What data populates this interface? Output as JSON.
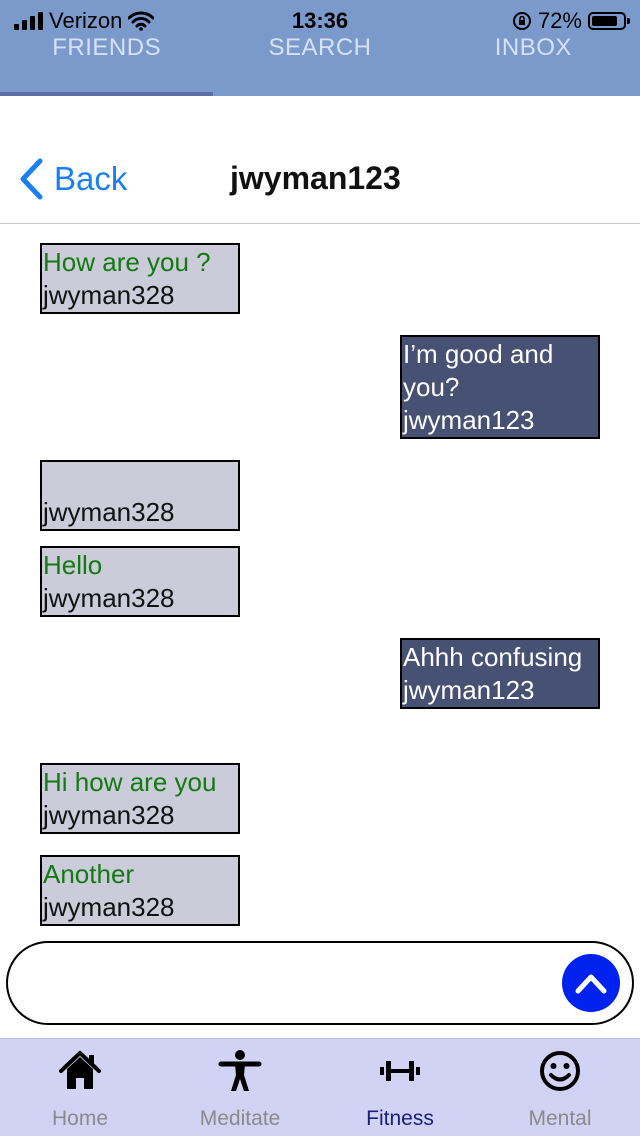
{
  "status_bar": {
    "carrier": "Verizon",
    "time": "13:36",
    "battery": "72%"
  },
  "tabs": [
    {
      "label": "FRIENDS",
      "active": true
    },
    {
      "label": "SEARCH",
      "active": false
    },
    {
      "label": "INBOX",
      "active": false
    }
  ],
  "header": {
    "back_label": "Back",
    "title": "jwyman123"
  },
  "messages": [
    {
      "text": "How are you ?",
      "user": "jwyman328",
      "direction": "in"
    },
    {
      "text": "I’m good and you?",
      "user": "jwyman123",
      "direction": "out"
    },
    {
      "text": "",
      "user": "jwyman328",
      "direction": "in"
    },
    {
      "text": "Hello",
      "user": "jwyman328",
      "direction": "in"
    },
    {
      "text": "Ahhh confusing",
      "user": "jwyman123",
      "direction": "out"
    },
    {
      "text": "Hi how are you",
      "user": "jwyman328",
      "direction": "in"
    },
    {
      "text": "Another",
      "user": "jwyman328",
      "direction": "in"
    }
  ],
  "composer": {
    "value": "",
    "placeholder": "",
    "send_icon": "chevron-up-icon"
  },
  "bottom_nav": [
    {
      "label": "Home",
      "icon": "home-icon",
      "active": false
    },
    {
      "label": "Meditate",
      "icon": "person-icon",
      "active": false
    },
    {
      "label": "Fitness",
      "icon": "dumbbell-icon",
      "active": true
    },
    {
      "label": "Mental",
      "icon": "smiley-icon",
      "active": false
    }
  ],
  "colors": {
    "top_bar": "#7b9acc",
    "incoming_bubble": "#cbcbd9",
    "outgoing_bubble": "#465173",
    "incoming_text": "#117a11",
    "send_button": "#0022ee",
    "bottom_nav": "#d2d3f4",
    "active_nav_label": "#18207a",
    "link_blue": "#1a7ff2"
  }
}
